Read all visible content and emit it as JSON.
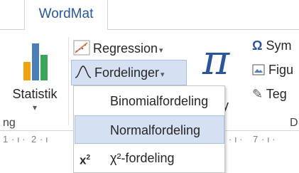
{
  "tabs": {
    "active": "WordMat"
  },
  "ribbon": {
    "statistik": {
      "label": "Statistik"
    },
    "regression": {
      "label": "Regression"
    },
    "fordelinger": {
      "label": "Fordelinger"
    },
    "ny": {
      "label": "Ny"
    },
    "right": {
      "symbol": "Sym",
      "figur": "Figu",
      "tegn": "Teg"
    },
    "group_labels": {
      "left": "ng",
      "right": "D"
    }
  },
  "ruler": {
    "ticks": [
      "1",
      "2",
      "7"
    ]
  },
  "menu": {
    "items": [
      {
        "label": "Binomialfordeling"
      },
      {
        "label": "Normalfordeling"
      },
      {
        "label": "χ²-fordeling",
        "icon": "x²"
      }
    ]
  },
  "colors": {
    "accent": "#2b579a",
    "highlight": "#d5e1f2",
    "highlight_border": "#a9c1e6"
  }
}
